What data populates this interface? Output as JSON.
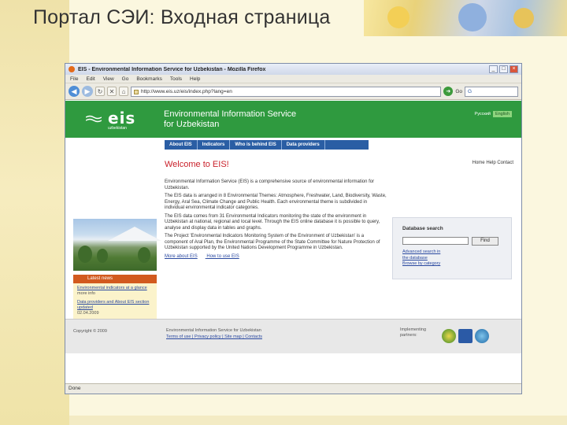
{
  "slide": {
    "title": "Портал СЭИ: Входная страница"
  },
  "browser": {
    "window_title": "EIS - Environmental Information Service for Uzbekistan - Mozilla Firefox",
    "menu": [
      "File",
      "Edit",
      "View",
      "Go",
      "Bookmarks",
      "Tools",
      "Help"
    ],
    "url": "http://www.eis.uz/eis/index.php?lang=en",
    "go_label": "Go",
    "search_value": "G",
    "status": "Done"
  },
  "site": {
    "logo_word": "eis",
    "logo_sub": "uzbekistan",
    "name_line1": "Environmental Information Service",
    "name_line2": "for Uzbekistan",
    "lang_label": "Русский",
    "lang_selected": "English",
    "nav": [
      "About EIS",
      "Indicators",
      "Who is behind EIS",
      "Data providers"
    ],
    "welcome": "Welcome to EIS!",
    "top_links": "Home Help Contact",
    "news_head": "Latest news",
    "news_items": [
      {
        "text": "Environmental indicators at a glance",
        "date": "more info"
      },
      {
        "text": "Data providers and About EIS section updated",
        "date": "02.04.2009"
      }
    ],
    "paragraphs": [
      "Environmental Information Service (EIS) is a comprehensive source of environmental information for Uzbekistan.",
      "The EIS data is arranged in 8 Environmental Themes: Atmosphere, Freshwater, Land, Biodiversity, Waste, Energy, Aral Sea, Climate Change and Public Health. Each environmental theme is subdivided in individual environmental indicator categories.",
      "The EIS data comes from 31 Environmental Indicators monitoring the state of the environment in Uzbekistan at national, regional and local level. Through the EIS online database it is possible to query, analyse and display data in tables and graphs.",
      "The Project 'Environmental Indicators Monitoring System of the Environment of Uzbekistan' is a component of Aral Plan, the Environmental Programme of the State Committee for Nature Protection of Uzbekistan supported by the United Nations Development Programme in Uzbekistan."
    ],
    "more_links": [
      "More about EIS",
      "How to use EIS"
    ],
    "db_search_title": "Database search",
    "find_label": "Find",
    "db_links": [
      "Advanced search in",
      "the database",
      "Browse by category"
    ],
    "footer_copy": "Copyright © 2009",
    "footer_mid": "Environmental Information Service for Uzbekistan",
    "footer_links": "Terms of use | Privacy policy | Site map | Contacts",
    "partners_label": [
      "Implementing",
      "partners:"
    ]
  }
}
